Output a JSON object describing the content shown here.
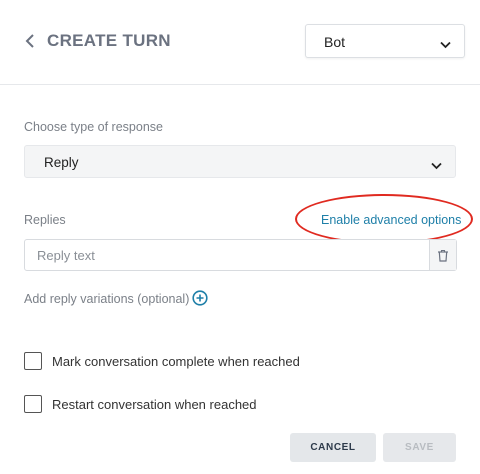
{
  "header": {
    "title": "CREATE TURN",
    "speaker_select": {
      "selected": "Bot"
    }
  },
  "response_type": {
    "label": "Choose type of response",
    "selected": "Reply"
  },
  "replies": {
    "label": "Replies",
    "advanced_link": "Enable advanced options",
    "input_placeholder": "Reply text",
    "add_variations": "Add reply variations (optional)"
  },
  "options": [
    {
      "label": "Mark conversation complete when reached",
      "checked": false
    },
    {
      "label": "Restart conversation when reached",
      "checked": false
    }
  ],
  "footer": {
    "cancel_label": "CANCEL",
    "save_label": "SAVE"
  },
  "colors": {
    "link": "#1e7fa8",
    "annotation": "#e02a20"
  }
}
